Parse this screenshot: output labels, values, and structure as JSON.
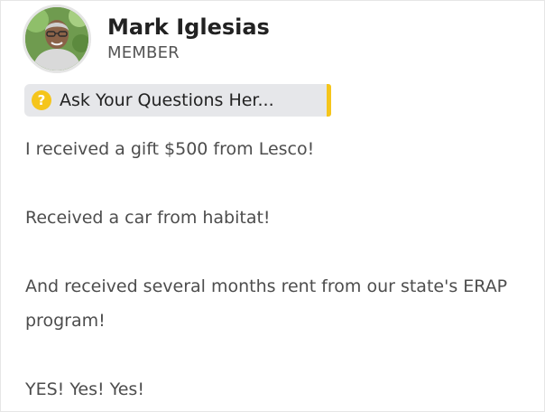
{
  "post": {
    "author": {
      "name": "Mark Iglesias",
      "role": "MEMBER"
    },
    "topic_tag": {
      "icon": "question-circle-icon",
      "label": "Ask Your Questions Her...",
      "accent_color": "#f5c51b"
    },
    "paragraphs": [
      "I received a gift $500 from Lesco!",
      "Received a car from habitat!",
      "And received several months rent from our state's ERAP program!",
      "YES! Yes! Yes!"
    ]
  }
}
